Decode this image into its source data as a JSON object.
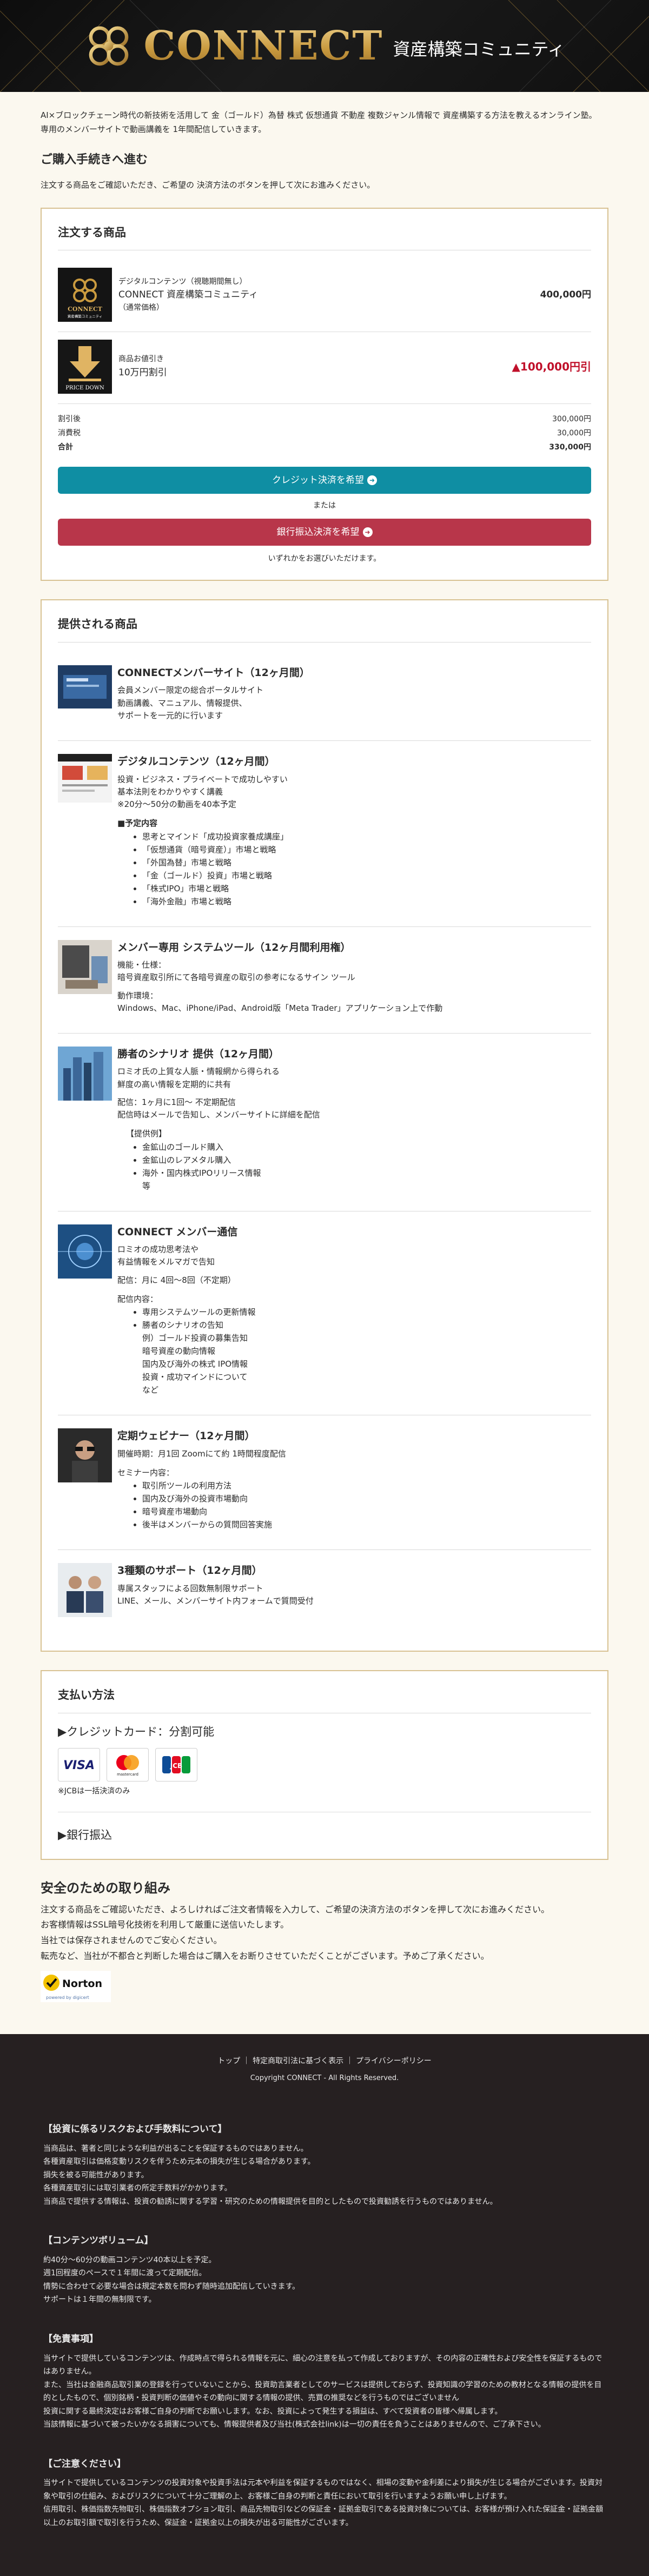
{
  "hero": {
    "brand": "CONNECT",
    "subtitle": "資産構築コミュニティ"
  },
  "intro": {
    "line1": "AI×ブロックチェーン時代の新技術を活用して 金（ゴールド）為替 株式 仮想通貨 不動産 複数ジャンル情報で 資産構築する方法を教えるオンライン塾。",
    "line2": "専用のメンバーサイトで動画講義を 1年間配信していきます。"
  },
  "procedure": {
    "title": "ご購入手続きへ進む",
    "lead": "注文する商品をご確認いただき、ご希望の 決済方法のボタンを押して次にお進みください。"
  },
  "order": {
    "title": "注文する商品",
    "item1": {
      "tag": "デジタルコンテンツ（視聴期間無し）",
      "name": "CONNECT 資産構築コミュニティ",
      "note": "（通常価格）",
      "price": "400,000円",
      "thumb_caption": "資産構築コミュニティ"
    },
    "item2": {
      "tag": "商品お値引き",
      "name": "10万円割引",
      "price": "▲100,000円引",
      "thumb_caption": "PRICE DOWN"
    },
    "totals": [
      {
        "label": "割引後",
        "value": "300,000円"
      },
      {
        "label": "消費税",
        "value": "30,000円"
      },
      {
        "label": "合計",
        "value": "330,000円"
      }
    ],
    "credit_button": "クレジット決済を希望",
    "or": "または",
    "bank_button": "銀行振込決済を希望",
    "choose": "いずれかをお選びいただけます。"
  },
  "products": {
    "title": "提供される商品",
    "items": [
      {
        "title": "CONNECTメンバーサイト（12ヶ月間）",
        "lines": [
          "会員メンバー限定の総合ポータルサイト",
          "動画講義、マニュアル、情報提供、",
          "サポートを一元的に行います"
        ]
      },
      {
        "title": "デジタルコンテンツ（12ヶ月間）",
        "lines": [
          "投資・ビジネス・プライベートで成功しやすい",
          "基本法則をわかりやすく講義",
          "※20分〜50分の動画を40本予定"
        ],
        "list_title": "■予定内容",
        "list": [
          "思考とマインド「成功投資家養成講座」",
          "「仮想通貨（暗号資産）」市場と戦略",
          "「外国為替」市場と戦略",
          "「金（ゴールド）投資」市場と戦略",
          "「株式IPO」市場と戦略",
          "「海外金融」市場と戦略"
        ]
      },
      {
        "title": "メンバー専用 システムツール（12ヶ月間利用権）",
        "lines": [
          "機能・仕様：",
          "暗号資産取引所にて各暗号資産の取引の参考になるサイン ツール",
          "動作環境：",
          "Windows、Mac、iPhone/iPad、Android版「Meta Trader」アプリケーション上で作動"
        ]
      },
      {
        "title": "勝者のシナリオ 提供（12ヶ月間）",
        "lines": [
          "ロミオ氏の上質な人脈・情報網から得られる",
          "鮮度の高い情報を定期的に共有",
          "配信：1ヶ月に1回〜 不定期配信",
          "配信時はメールで告知し、メンバーサイトに詳細を配信"
        ],
        "list_title": "【提供例】",
        "list": [
          "金鉱山のゴールド購入",
          "金鉱山のレアメタル購入",
          "海外・国内株式IPOリリース情報",
          "等"
        ]
      },
      {
        "title": "CONNECT メンバー通信",
        "lines": [
          "ロミオの成功思考法や",
          "有益情報をメルマガで告知",
          "配信：月に 4回〜8回（不定期）"
        ],
        "list_title": "配信内容：",
        "list": [
          "専用システムツールの更新情報",
          "勝者のシナリオの告知",
          "例）ゴールド投資の募集告知",
          "暗号資産の動向情報",
          "国内及び海外の株式 IPO情報",
          "投資・成功マインドについて",
          "など"
        ]
      },
      {
        "title": "定期ウェビナー（12ヶ月間）",
        "lines": [
          "開催時期：月1回 Zoomにて約 1時間程度配信"
        ],
        "list_title": "セミナー内容：",
        "list": [
          "取引所ツールの利用方法",
          "国内及び海外の投資市場動向",
          "暗号資産市場動向",
          "後半はメンバーからの質問回答実施"
        ]
      },
      {
        "title": "3種類のサポート（12ヶ月間）",
        "lines": [
          "専属スタッフによる回数無制限サポート",
          "LINE、メール、メンバーサイト内フォームで質問受付"
        ]
      }
    ]
  },
  "payment": {
    "title": "支払い方法",
    "credit": "▶クレジットカード：分割可能",
    "logos": [
      "VISA",
      "mastercard",
      "JCB"
    ],
    "jcb_note": "※JCBは一括決済のみ",
    "bank": "▶銀行振込"
  },
  "safety": {
    "title": "安全のための取り組み",
    "lines": [
      "注文する商品をご確認いただき、よろしければご注文者情報を入力して、ご希望の決済方法のボタンを押して次にお進みください。",
      "お客様情報はSSL暗号化技術を利用して厳重に送信いたします。",
      "当社では保存されませんのでご安心ください。",
      "転売など、当社が不都合と判断した場合はご購入をお断りさせていただくことがございます。予めご了承ください。"
    ],
    "norton": "Norton",
    "norton_sub": "powered by digicert"
  },
  "footer": {
    "links": "トップ ｜ 特定商取引法に基づく表示 ｜ プライバシーポリシー",
    "copyright": "Copyright CONNECT - All Rights Reserved.",
    "sections": [
      {
        "title": "【投資に係るリスクおよび手数料について】",
        "text": [
          "当商品は、著者と同じような利益が出ることを保証するものではありません。",
          "各種資産取引は価格変動リスクを伴うため元本の損失が生じる場合があります。",
          "損失を被る可能性があります。",
          "各種資産取引には取引業者の所定手数料がかかります。",
          "当商品で提供する情報は、投資の勧誘に関する学習・研究のための情報提供を目的としたもので投資勧誘を行うものではありません。"
        ]
      },
      {
        "title": "【コンテンツボリューム】",
        "text": [
          "約40分〜60分の動画コンテンツ40本以上を予定。",
          "週1回程度のペースで１年間に渡って定期配信。",
          "情勢に合わせて必要な場合は規定本数を問わず随時追加配信していきます。",
          "サポートは１年間の無制限です。"
        ]
      },
      {
        "title": "【免責事項】",
        "text": [
          "当サイトで提供しているコンテンツは、作成時点で得られる情報を元に、細心の注意を払って作成しておりますが、その内容の正確性および安全性を保証するものではありません。",
          "また、当社は金融商品取引業の登録を行っていないことから、投資助言業者としてのサービスは提供しておらず、投資知識の学習のための教材となる情報の提供を目的としたもので、個別銘柄・投資判断の価値やその動向に関する情報の提供、売買の推奨などを行うものではございません",
          "投資に関する最終決定はお客様ご自身の判断でお願いします。なお、投資によって発生する損益は、すべて投資者の皆様へ帰属します。",
          "当該情報に基づいて被ったいかなる損害についても、情報提供者及び当社(株式会社link)は一切の責任を負うことはありませんので、ご了承下さい。"
        ]
      },
      {
        "title": "【ご注意ください】",
        "text": [
          "当サイトで提供しているコンテンツの投資対象や投資手法は元本や利益を保証するものではなく、相場の変動や金利差により損失が生じる場合がございます。投資対象や取引の仕組み、およびリスクについて十分ご理解の上、お客様ご自身の判断と責任において取引を行いますようお願い申し上げます。",
          "信用取引、株価指数先物取引、株価指数オプション取引、商品先物取引などの保証金・証拠金取引である投資対象については、お客様が預け入れた保証金・証拠金額以上のお取引額で取引を行うため、保証金・証拠金以上の損失が出る可能性がございます。"
        ]
      }
    ]
  }
}
